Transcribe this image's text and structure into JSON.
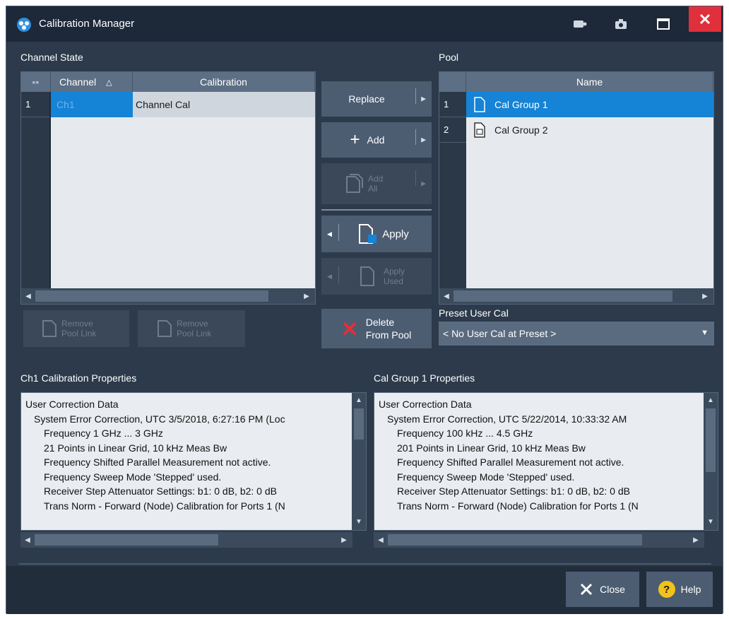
{
  "window": {
    "title": "Calibration Manager"
  },
  "channel_state": {
    "label": "Channel State",
    "columns": [
      "Channel",
      "Calibration"
    ],
    "sort_icon": "△",
    "rows": [
      {
        "num": "1",
        "channel": "Ch1",
        "calibration": "Channel Cal"
      }
    ],
    "remove_pool_link_1": "Remove Pool Link",
    "remove_pool_link_2": "Remove Pool Link"
  },
  "middle": {
    "replace": "Replace",
    "add": "Add",
    "add_all": "Add All",
    "apply": "Apply",
    "apply_all": "Apply Used",
    "delete_line1": "Delete",
    "delete_line2": "From Pool"
  },
  "pool": {
    "label": "Pool",
    "column": "Name",
    "rows": [
      {
        "num": "1",
        "name": "Cal Group 1",
        "selected": true
      },
      {
        "num": "2",
        "name": "Cal Group 2",
        "selected": false
      }
    ]
  },
  "preset": {
    "label": "Preset User Cal",
    "value": "< No User Cal at Preset >"
  },
  "ch1_props": {
    "label": "Ch1 Calibration Properties",
    "lines": [
      "User Correction Data",
      "  System Error Correction, UTC 3/5/2018, 6:27:16 PM (Loc",
      "    Frequency 1 GHz ... 3 GHz",
      "    21 Points in Linear Grid, 10 kHz Meas Bw",
      "    Frequency Shifted Parallel Measurement not active.",
      "    Frequency Sweep Mode 'Stepped' used.",
      "    Receiver Step Attenuator Settings: b1: 0 dB, b2: 0 dB",
      "    Trans Norm - Forward (Node) Calibration for Ports 1 (N"
    ]
  },
  "group_props": {
    "label": "Cal Group 1 Properties",
    "lines": [
      "User Correction Data",
      "  System Error Correction, UTC 5/22/2014, 10:33:32 AM",
      "    Frequency 100 kHz ... 4.5 GHz",
      "    201 Points in Linear Grid, 10 kHz Meas Bw",
      "    Frequency Shifted Parallel Measurement not active.",
      "    Frequency Sweep Mode 'Stepped' used.",
      "    Receiver Step Attenuator Settings: b1: 0 dB, b2: 0 dB",
      "    Trans Norm - Forward (Node) Calibration for Ports 1 (N"
    ]
  },
  "footer": {
    "close": "Close",
    "help": "Help"
  },
  "colors": {
    "window_bg": "#2c3a4b",
    "titlebar_bg": "#1d2838",
    "selection_blue": "#1583d6",
    "close_red": "#e0303b",
    "button_bg": "#4c5d72",
    "help_yellow": "#f2c21a"
  },
  "icons": [
    "app-logo-icon",
    "record-icon",
    "camera-icon",
    "maximize-icon",
    "close-icon",
    "sort-asc-icon",
    "file-icon",
    "document-icon",
    "plus-icon",
    "apply-icon",
    "delete-x-icon",
    "dropdown-arrow-icon",
    "help-icon"
  ]
}
